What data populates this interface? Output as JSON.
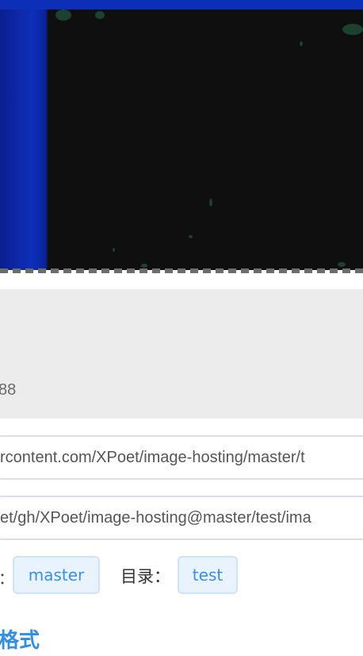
{
  "info": {
    "value_fragment": "88"
  },
  "links": {
    "raw_url": "rcontent.com/XPoet/image-hosting/master/t",
    "cdn_url": "et/gh/XPoet/image-hosting@master/test/ima"
  },
  "meta": {
    "separator": "：",
    "branch_tag": "master",
    "dir_label": "目录：",
    "dir_tag": "test"
  },
  "format_section": {
    "heading_fragment": "格式"
  },
  "colors": {
    "accent": "#2f8ee8",
    "tag_bg": "#e9f3fe",
    "card_bg": "#ececec",
    "preview_blue": "#0d2fb8",
    "preview_dark": "#0f0f10"
  }
}
